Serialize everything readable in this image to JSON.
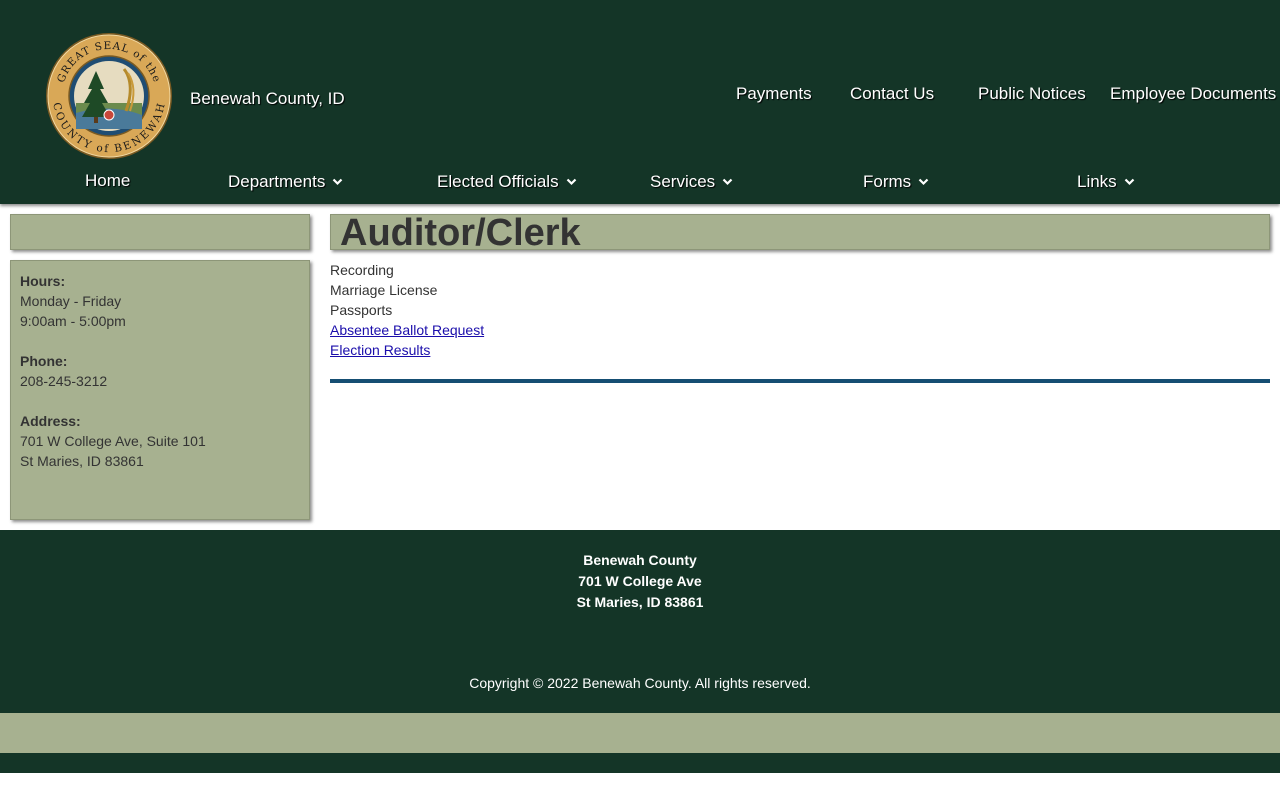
{
  "header": {
    "seal_text_top": "GREAT SEAL of the",
    "seal_text_bottom": "COUNTY of BENEWAH",
    "site_name": "Benewah County, ID",
    "top_links": [
      "Payments",
      "Contact Us",
      "Public Notices",
      "Employee Documents"
    ],
    "nav": [
      {
        "label": "Home",
        "has_dropdown": false
      },
      {
        "label": "Departments",
        "has_dropdown": true
      },
      {
        "label": "Elected Officials",
        "has_dropdown": true
      },
      {
        "label": "Services",
        "has_dropdown": true
      },
      {
        "label": "Forms",
        "has_dropdown": true
      },
      {
        "label": "Links",
        "has_dropdown": true
      }
    ],
    "icons": {
      "dropdown": "chevron-down-icon",
      "logo": "county-seal-logo"
    }
  },
  "sidebar": {
    "hours_label": "Hours:",
    "hours_days": "Monday - Friday",
    "hours_time": "9:00am - 5:00pm",
    "phone_label": "Phone:",
    "phone": "208-245-3212",
    "address_label": "Address:",
    "address_line1": "701 W College Ave, Suite 101",
    "address_line2": "St Maries, ID 83861"
  },
  "main": {
    "title": "Auditor/Clerk",
    "items": [
      "Recording",
      "Marriage License",
      "Passports"
    ],
    "links": [
      "Absentee Ballot Request",
      "Election Results"
    ]
  },
  "footer": {
    "name": "Benewah County",
    "address_line1": "701 W College Ave",
    "address_line2": "St Maries, ID 83861",
    "copyright": "Copyright © 2022 Benewah County. All rights reserved."
  },
  "colors": {
    "header_bg": "#143527",
    "panel_bg": "#a7b190",
    "divider": "#154e73",
    "link": "#1a0dab",
    "text": "#333333"
  }
}
